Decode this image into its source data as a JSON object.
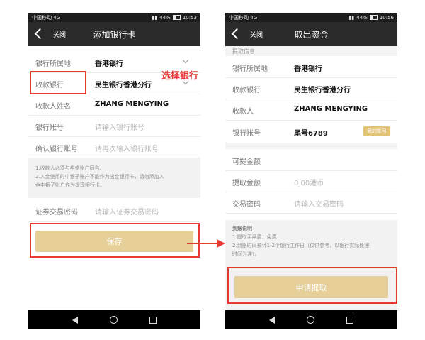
{
  "status_left": {
    "carrier": "中国移动",
    "signal": "4G"
  },
  "status_right_a": {
    "battery": "44%",
    "time": "10:53"
  },
  "status_right_b": {
    "battery": "44%",
    "time": "10:56"
  },
  "screen1": {
    "close_label": "关闭",
    "title": "添加银行卡",
    "fields": [
      {
        "label": "银行所属地",
        "value": "香港银行"
      },
      {
        "label": "收款银行",
        "value": "民生银行香港分行"
      },
      {
        "label": "收款人姓名",
        "value": "ZHANG MENGYING"
      },
      {
        "label": "银行账号",
        "placeholder": "请输入银行账号"
      },
      {
        "label": "确认银行账号",
        "placeholder": "请再次输入银行账号"
      }
    ],
    "note_lines": [
      "1.收款人必须与华盛账户同名。",
      "2.入金使用的中银子账户不能作为出金银行卡，请勿添加入",
      "金中银子账户作为提现银行卡。"
    ],
    "password_field": {
      "label": "证券交易密码",
      "placeholder": "请输入证券交易密码"
    },
    "save_button": "保存",
    "annotation": "选择银行"
  },
  "screen2": {
    "close_label": "关闭",
    "title": "取出资金",
    "section_label": "提取信息",
    "fields": [
      {
        "label": "银行所属地",
        "value": "香港银行"
      },
      {
        "label": "收款银行",
        "value": "民生银行香港分行"
      },
      {
        "label": "收款人",
        "value": "ZHANG MENGYING"
      },
      {
        "label": "银行账号",
        "value": "尾号6789"
      }
    ],
    "account_badge": "我的账号",
    "amount_fields": [
      {
        "label": "可提金额",
        "value": ""
      },
      {
        "label": "提取金额",
        "placeholder": "0.00港币"
      },
      {
        "label": "交易密码",
        "placeholder": "请输入交易密码"
      }
    ],
    "note_title": "到账说明",
    "note_lines": [
      "1.提取手续费：免费",
      "2.到账时间预计1-2个银行工作日（仅供参考，以银行实际处理",
      "时间为准）。"
    ],
    "submit_button": "申请提取"
  },
  "colors": {
    "accent_gold": "#e6cf98",
    "annotation_red": "#e53935",
    "header_dark": "#2b2b2b"
  }
}
